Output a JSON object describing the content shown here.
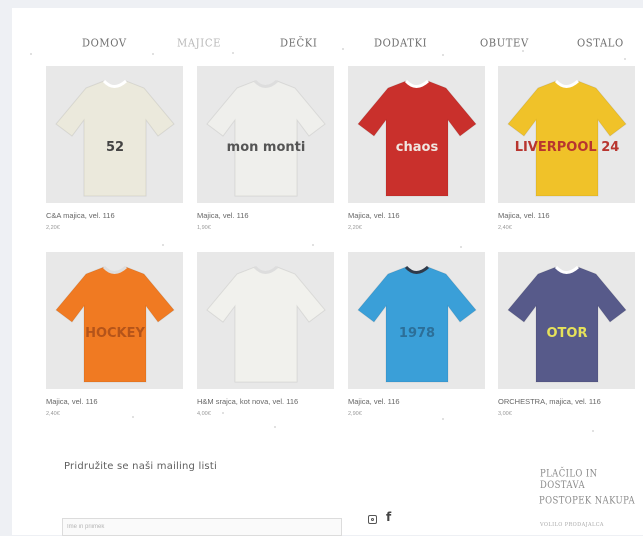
{
  "nav": {
    "items": [
      {
        "label": "DOMOV",
        "active": false
      },
      {
        "label": "MAJICE",
        "active": true
      },
      {
        "label": "DEČKI",
        "active": false
      },
      {
        "label": "DODATKI",
        "active": false
      },
      {
        "label": "OBUTEV",
        "active": false
      },
      {
        "label": "OSTALO",
        "active": false
      }
    ]
  },
  "products": [
    {
      "title": "C&A majica, vel. 116",
      "price": "2,20€",
      "color": "#ebe9dc",
      "print": "52",
      "print_color": "#444"
    },
    {
      "title": "Majica, vel. 116",
      "price": "1,90€",
      "color": "#efefec",
      "print": "mon monti",
      "print_color": "#555"
    },
    {
      "title": "Majica, vel. 116",
      "price": "2,20€",
      "color": "#c9302c",
      "print": "chaos",
      "print_color": "#f0e6e0"
    },
    {
      "title": "Majica, vel. 116",
      "price": "2,40€",
      "color": "#f0c229",
      "print": "LIVERPOOL 24",
      "print_color": "#b8352f"
    },
    {
      "title": "Majica, vel. 116",
      "price": "2,40€",
      "color": "#f07a22",
      "print": "HOCKEY",
      "print_color": "#b4541a"
    },
    {
      "title": "H&M srajca, kot nova, vel. 116",
      "price": "4,00€",
      "color": "#f1f1ed",
      "print": "",
      "print_color": "#888"
    },
    {
      "title": "Majica, vel. 116",
      "price": "2,90€",
      "color": "#3a9fd8",
      "print": "1978",
      "print_color": "#2c6f99"
    },
    {
      "title": "ORCHESTRA, majica, vel. 116",
      "price": "3,00€",
      "color": "#575a8a",
      "print": "OTOR",
      "print_color": "#e6e25a"
    }
  ],
  "footer": {
    "mailing_title": "Pridružite se naši mailing listi",
    "name_placeholder": "Ime in priimek",
    "links": [
      "PLAČILO IN DOSTAVA",
      "POSTOPEK NAKUPA",
      "VOLILO PRODAJALCA"
    ]
  },
  "colors": {
    "background": "#eef0f4",
    "page": "#ffffff",
    "nav_text": "#6f6f6f",
    "nav_active": "#b9b9b9"
  }
}
